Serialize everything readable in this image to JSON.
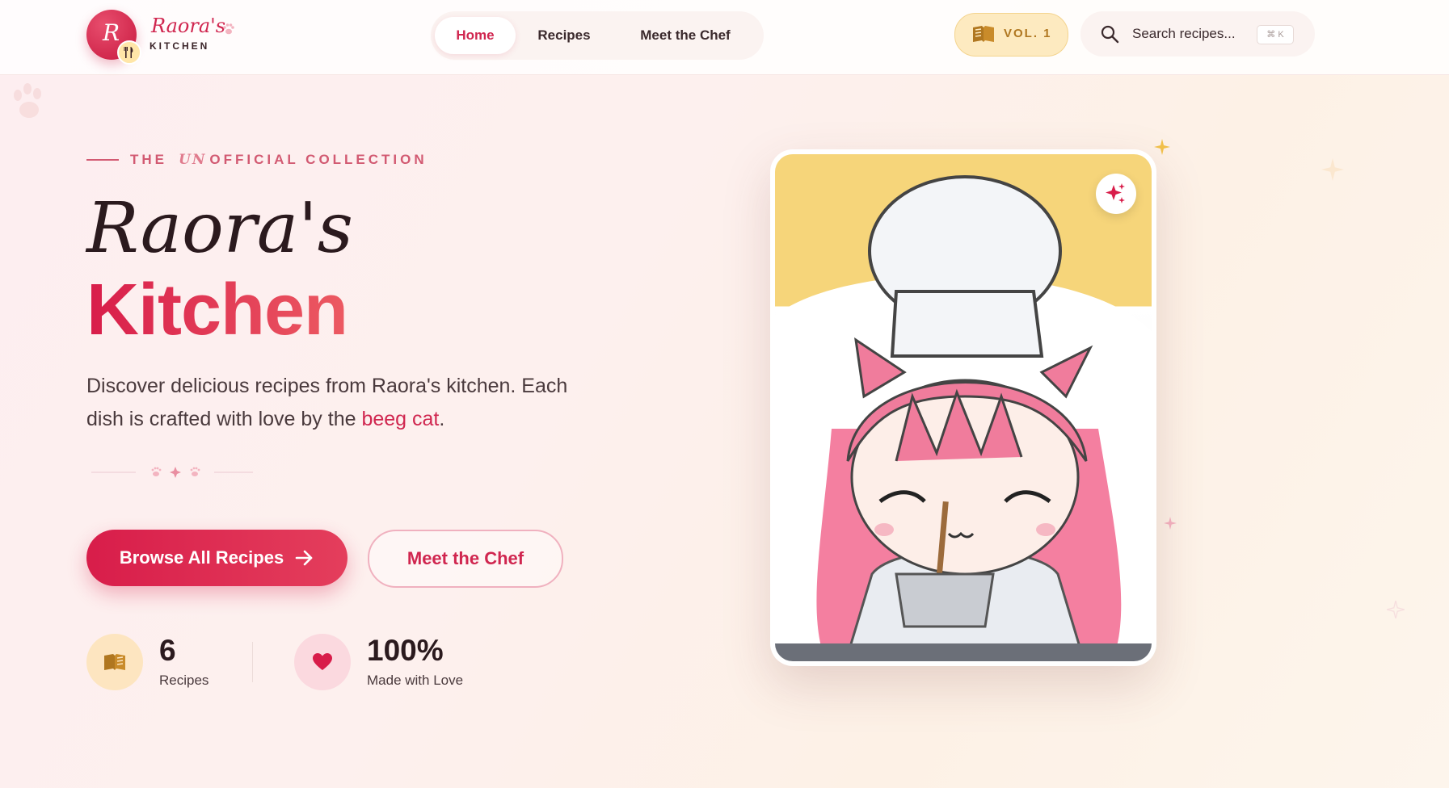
{
  "brand": {
    "logo_letter": "R",
    "name": "Raora's",
    "sub": "KITCHEN"
  },
  "nav": {
    "items": [
      {
        "label": "Home",
        "active": true
      },
      {
        "label": "Recipes",
        "active": false
      },
      {
        "label": "Meet the Chef",
        "active": false
      }
    ]
  },
  "volume": {
    "label": "VOL. 1"
  },
  "search": {
    "placeholder": "Search recipes...",
    "shortcut": "⌘ K"
  },
  "hero": {
    "eyebrow_pre": "THE",
    "eyebrow_un": "UN",
    "eyebrow_post": "OFFICIAL COLLECTION",
    "title_line1": "Raora's",
    "title_line2": "Kitchen",
    "description_pre": "Discover delicious recipes from Raora's kitchen. Each dish is crafted with love by the",
    "description_accent": "beeg cat",
    "description_post": ".",
    "primary_button": "Browse All Recipes",
    "secondary_button": "Meet the Chef"
  },
  "stats": [
    {
      "value": "6",
      "label": "Recipes",
      "icon": "book-icon"
    },
    {
      "value": "100%",
      "label": "Made with Love",
      "icon": "heart-icon"
    }
  ],
  "colors": {
    "accent": "#d0264f",
    "gold": "#f6d57a",
    "background": "#fdeef0"
  }
}
